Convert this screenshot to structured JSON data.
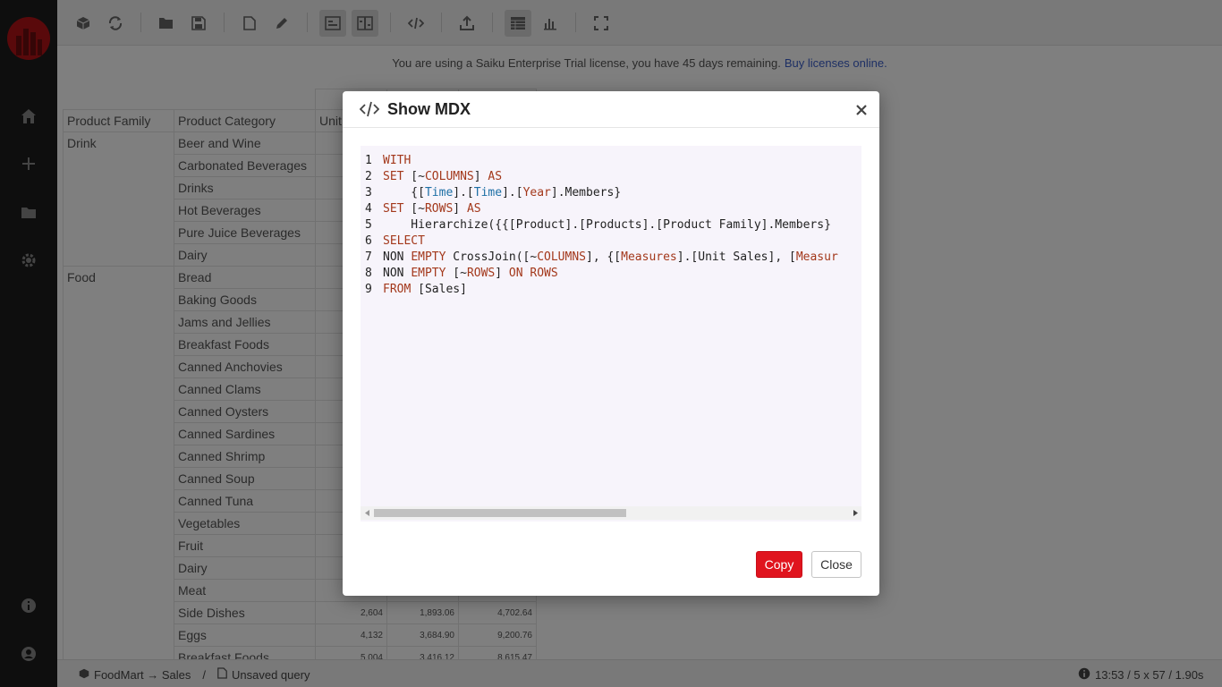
{
  "toolbar": {
    "buttons": [
      "cube-icon",
      "refresh-icon",
      "folder-open-icon",
      "save-icon",
      "new-file-icon",
      "pencil-icon",
      "query-mode-icon",
      "columns-mode-icon",
      "code-icon",
      "upload-icon",
      "table-icon",
      "chart-icon",
      "fullscreen-icon"
    ]
  },
  "banner": {
    "text": "You are using a Saiku Enterprise Trial license, you have 45 days remaining.",
    "link": "Buy licenses online."
  },
  "table": {
    "headers": [
      "Product Family",
      "Product Category",
      "Unit"
    ],
    "rows": [
      {
        "family": "Drink",
        "category": "Beer and Wine",
        "v1": "",
        "v2": "",
        "v3": ""
      },
      {
        "family": "",
        "category": "Carbonated Beverages",
        "v1": "",
        "v2": "",
        "v3": ""
      },
      {
        "family": "",
        "category": "Drinks",
        "v1": "",
        "v2": "",
        "v3": ""
      },
      {
        "family": "",
        "category": "Hot Beverages",
        "v1": "",
        "v2": "",
        "v3": ""
      },
      {
        "family": "",
        "category": "Pure Juice Beverages",
        "v1": "",
        "v2": "",
        "v3": ""
      },
      {
        "family": "",
        "category": "Dairy",
        "v1": "",
        "v2": "",
        "v3": ""
      },
      {
        "family": "Food",
        "category": "Bread",
        "v1": "",
        "v2": "",
        "v3": ""
      },
      {
        "family": "",
        "category": "Baking Goods",
        "v1": "",
        "v2": "",
        "v3": ""
      },
      {
        "family": "",
        "category": "Jams and Jellies",
        "v1": "",
        "v2": "",
        "v3": ""
      },
      {
        "family": "",
        "category": "Breakfast Foods",
        "v1": "",
        "v2": "",
        "v3": ""
      },
      {
        "family": "",
        "category": "Canned Anchovies",
        "v1": "",
        "v2": "",
        "v3": ""
      },
      {
        "family": "",
        "category": "Canned Clams",
        "v1": "",
        "v2": "",
        "v3": ""
      },
      {
        "family": "",
        "category": "Canned Oysters",
        "v1": "",
        "v2": "",
        "v3": ""
      },
      {
        "family": "",
        "category": "Canned Sardines",
        "v1": "",
        "v2": "",
        "v3": ""
      },
      {
        "family": "",
        "category": "Canned Shrimp",
        "v1": "",
        "v2": "",
        "v3": ""
      },
      {
        "family": "",
        "category": "Canned Soup",
        "v1": "",
        "v2": "",
        "v3": ""
      },
      {
        "family": "",
        "category": "Canned Tuna",
        "v1": "",
        "v2": "",
        "v3": ""
      },
      {
        "family": "",
        "category": "Vegetables",
        "v1": "",
        "v2": "",
        "v3": ""
      },
      {
        "family": "",
        "category": "Fruit",
        "v1": "",
        "v2": "",
        "v3": ""
      },
      {
        "family": "",
        "category": "Dairy",
        "v1": "",
        "v2": "",
        "v3": ""
      },
      {
        "family": "",
        "category": "Meat",
        "v1": "",
        "v2": "",
        "v3": ""
      },
      {
        "family": "",
        "category": "Side Dishes",
        "v1": "2,604",
        "v2": "1,893.06",
        "v3": "4,702.64"
      },
      {
        "family": "",
        "category": "Eggs",
        "v1": "4,132",
        "v2": "3,684.90",
        "v3": "9,200.76"
      },
      {
        "family": "",
        "category": "Breakfast Foods",
        "v1": "5,004",
        "v2": "3,416.12",
        "v3": "8,615.47"
      }
    ]
  },
  "statusbar": {
    "cube": "FoodMart → Sales",
    "separator": "/",
    "query": "Unsaved query",
    "stats": "13:53 / 5 x 57 / 1.90s"
  },
  "modal": {
    "title": "Show MDX",
    "copy_label": "Copy",
    "close_label": "Close",
    "code": [
      {
        "n": "1",
        "tokens": [
          {
            "t": "kw",
            "s": "WITH"
          }
        ]
      },
      {
        "n": "2",
        "tokens": [
          {
            "t": "kw",
            "s": "SET"
          },
          {
            "t": "plain",
            "s": " [~"
          },
          {
            "t": "kw",
            "s": "COLUMNS"
          },
          {
            "t": "plain",
            "s": "] "
          },
          {
            "t": "kw",
            "s": "AS"
          }
        ]
      },
      {
        "n": "3",
        "tokens": [
          {
            "t": "plain",
            "s": "    {["
          },
          {
            "t": "id",
            "s": "Time"
          },
          {
            "t": "plain",
            "s": "].["
          },
          {
            "t": "id",
            "s": "Time"
          },
          {
            "t": "plain",
            "s": "].["
          },
          {
            "t": "kw",
            "s": "Year"
          },
          {
            "t": "plain",
            "s": "].Members}"
          }
        ]
      },
      {
        "n": "4",
        "tokens": [
          {
            "t": "kw",
            "s": "SET"
          },
          {
            "t": "plain",
            "s": " [~"
          },
          {
            "t": "kw",
            "s": "ROWS"
          },
          {
            "t": "plain",
            "s": "] "
          },
          {
            "t": "kw",
            "s": "AS"
          }
        ]
      },
      {
        "n": "5",
        "tokens": [
          {
            "t": "plain",
            "s": "    Hierarchize({{[Product].[Products].[Product Family].Members}"
          }
        ]
      },
      {
        "n": "6",
        "tokens": [
          {
            "t": "kw",
            "s": "SELECT"
          }
        ]
      },
      {
        "n": "7",
        "tokens": [
          {
            "t": "plain",
            "s": "NON "
          },
          {
            "t": "kw",
            "s": "EMPTY"
          },
          {
            "t": "plain",
            "s": " CrossJoin([~"
          },
          {
            "t": "kw",
            "s": "COLUMNS"
          },
          {
            "t": "plain",
            "s": "], {["
          },
          {
            "t": "kw",
            "s": "Measures"
          },
          {
            "t": "plain",
            "s": "].[Unit Sales], ["
          },
          {
            "t": "kw",
            "s": "Measur"
          }
        ]
      },
      {
        "n": "8",
        "tokens": [
          {
            "t": "plain",
            "s": "NON "
          },
          {
            "t": "kw",
            "s": "EMPTY"
          },
          {
            "t": "plain",
            "s": " [~"
          },
          {
            "t": "kw",
            "s": "ROWS"
          },
          {
            "t": "plain",
            "s": "] "
          },
          {
            "t": "kw",
            "s": "ON ROWS"
          }
        ]
      },
      {
        "n": "9",
        "tokens": [
          {
            "t": "kw",
            "s": "FROM"
          },
          {
            "t": "plain",
            "s": " [Sales]"
          }
        ]
      }
    ]
  }
}
